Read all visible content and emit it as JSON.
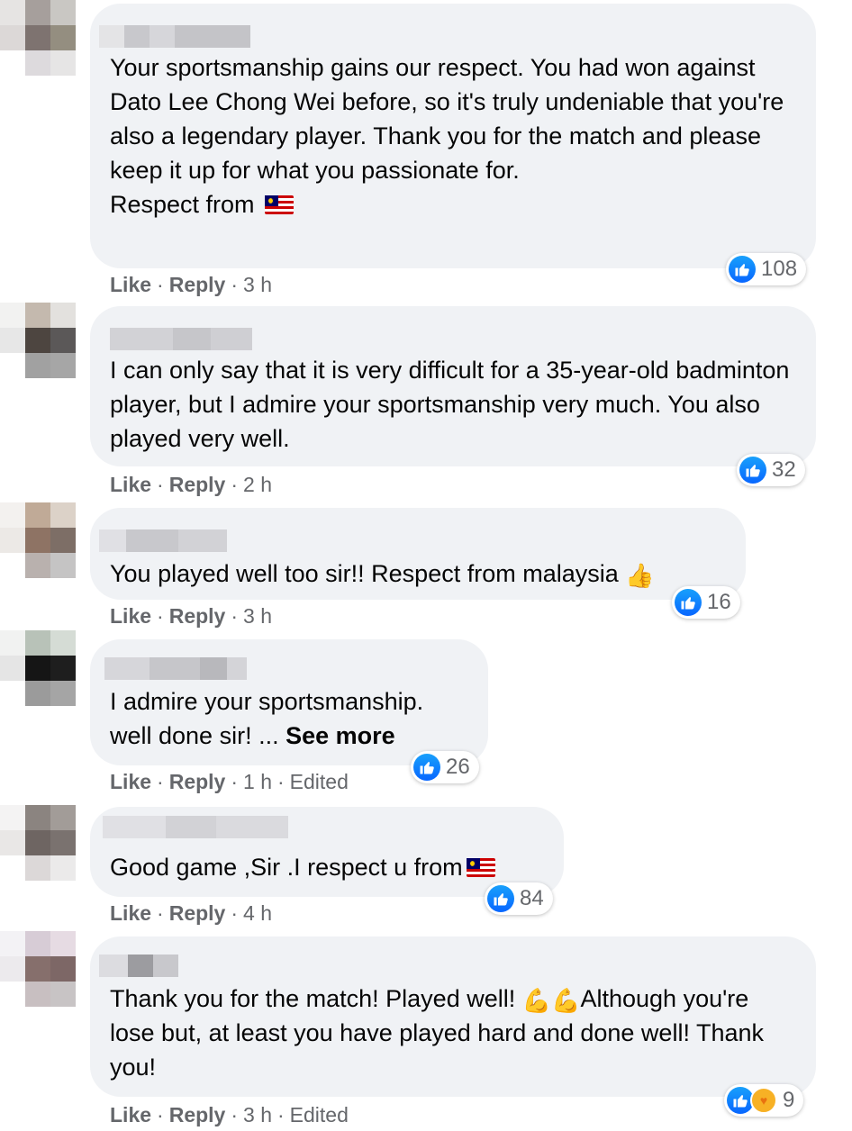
{
  "comments": [
    {
      "text": "Your sportsmanship gains our respect. You had won against Dato Lee Chong Wei before, so it's truly undeniable that you're also a legendary player. Thank you for the match and please keep it up for what you passionate for.\nRespect from ",
      "like": "Like",
      "reply": "Reply",
      "time": "3 h",
      "reactions": "108"
    },
    {
      "text": "I can only say that it is very difficult for a 35-year-old badminton player, but I admire your sportsmanship very much. You also played very well.",
      "like": "Like",
      "reply": "Reply",
      "time": "2 h",
      "reactions": "32"
    },
    {
      "text": "You played well too sir!! Respect from malaysia ",
      "like": "Like",
      "reply": "Reply",
      "time": "3 h",
      "reactions": "16"
    },
    {
      "text": "I admire your sportsmanship.\nwell done sir! ... ",
      "see_more": "See more",
      "like": "Like",
      "reply": "Reply",
      "time": "1 h",
      "edited": "Edited",
      "reactions": "26"
    },
    {
      "text": "Good game ,Sir .I respect u from",
      "like": "Like",
      "reply": "Reply",
      "time": "4 h",
      "reactions": "84"
    },
    {
      "text_a": "Thank you for the match! Played well! ",
      "text_b": "Although you're lose but, at least you have played hard and done well! Thank you!",
      "like": "Like",
      "reply": "Reply",
      "time": "3 h",
      "edited": "Edited",
      "reactions": "9"
    }
  ],
  "colors": {
    "bubble": "#f0f2f5",
    "meta": "#65676b",
    "like_blue": "#0866ff"
  },
  "icons": [
    "like-reaction-icon",
    "care-reaction-icon",
    "malaysia-flag-icon",
    "thumbs-up-emoji-icon",
    "flexed-biceps-emoji-icon"
  ]
}
